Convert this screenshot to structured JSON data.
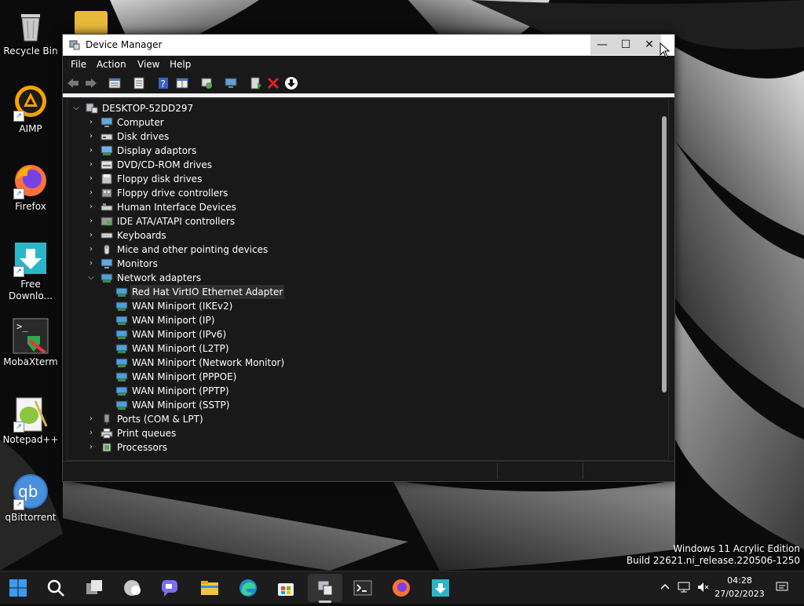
{
  "desktop": {
    "icons": [
      {
        "name": "recycle-bin-icon",
        "label": "Recycle Bin"
      },
      {
        "name": "aimp-icon",
        "label": "AIMP"
      },
      {
        "name": "firefox-icon",
        "label": "Firefox"
      },
      {
        "name": "free-download-manager-icon",
        "label": "Free Downlo..."
      },
      {
        "name": "mobaxterm-icon",
        "label": "MobaXterm"
      },
      {
        "name": "notepad-plus-plus-icon",
        "label": "Notepad++"
      },
      {
        "name": "qbittorrent-icon",
        "label": "qBittorrent"
      }
    ]
  },
  "window": {
    "title": "Device Manager",
    "controls": {
      "minimize": "—",
      "maximize": "☐",
      "close": "✕"
    },
    "menu": [
      "File",
      "Action",
      "View",
      "Help"
    ],
    "toolbar_icons": [
      "back-arrow-icon",
      "forward-arrow-icon",
      "properties-icon",
      "update-driver-icon",
      "help-icon",
      "show-hidden-icon",
      "scan-hardware-icon",
      "monitor-icon",
      "enable-device-icon",
      "uninstall-device-icon",
      "download-driver-icon"
    ],
    "tree": {
      "root": "DESKTOP-52DD297",
      "categories": [
        {
          "label": "Computer",
          "icon": "computer-icon",
          "expanded": false
        },
        {
          "label": "Disk drives",
          "icon": "disk-drive-icon",
          "expanded": false
        },
        {
          "label": "Display adaptors",
          "icon": "display-adapter-icon",
          "expanded": false
        },
        {
          "label": "DVD/CD-ROM drives",
          "icon": "dvd-drive-icon",
          "expanded": false
        },
        {
          "label": "Floppy disk drives",
          "icon": "floppy-disk-icon",
          "expanded": false
        },
        {
          "label": "Floppy drive controllers",
          "icon": "floppy-controller-icon",
          "expanded": false
        },
        {
          "label": "Human Interface Devices",
          "icon": "hid-icon",
          "expanded": false
        },
        {
          "label": "IDE ATA/ATAPI controllers",
          "icon": "ide-controller-icon",
          "expanded": false
        },
        {
          "label": "Keyboards",
          "icon": "keyboard-icon",
          "expanded": false
        },
        {
          "label": "Mice and other pointing devices",
          "icon": "mouse-icon",
          "expanded": false
        },
        {
          "label": "Monitors",
          "icon": "monitor-icon",
          "expanded": false
        },
        {
          "label": "Network adapters",
          "icon": "network-adapter-icon",
          "expanded": true
        }
      ],
      "network_children": [
        {
          "label": "Red Hat VirtIO Ethernet Adapter",
          "selected": true
        },
        {
          "label": "WAN Miniport (IKEv2)"
        },
        {
          "label": "WAN Miniport (IP)"
        },
        {
          "label": "WAN Miniport (IPv6)"
        },
        {
          "label": "WAN Miniport (L2TP)"
        },
        {
          "label": "WAN Miniport (Network Monitor)"
        },
        {
          "label": "WAN Miniport (PPPOE)"
        },
        {
          "label": "WAN Miniport (PPTP)"
        },
        {
          "label": "WAN Miniport (SSTP)"
        }
      ],
      "after": [
        {
          "label": "Ports (COM & LPT)",
          "icon": "port-icon"
        },
        {
          "label": "Print queues",
          "icon": "printer-icon"
        },
        {
          "label": "Processors",
          "icon": "processor-icon"
        }
      ]
    }
  },
  "watermark": {
    "line1": "Windows 11 Acrylic Edition",
    "line2": "Build 22621.ni_release.220506-1250"
  },
  "taskbar": {
    "apps": [
      "start-icon",
      "search-icon",
      "task-view-icon",
      "widgets-icon",
      "chat-icon",
      "file-explorer-icon",
      "edge-icon",
      "store-icon",
      "device-manager-icon",
      "terminal-icon",
      "firefox-icon",
      "free-download-manager-icon"
    ],
    "time": "04:28",
    "date": "27/02/2023"
  }
}
